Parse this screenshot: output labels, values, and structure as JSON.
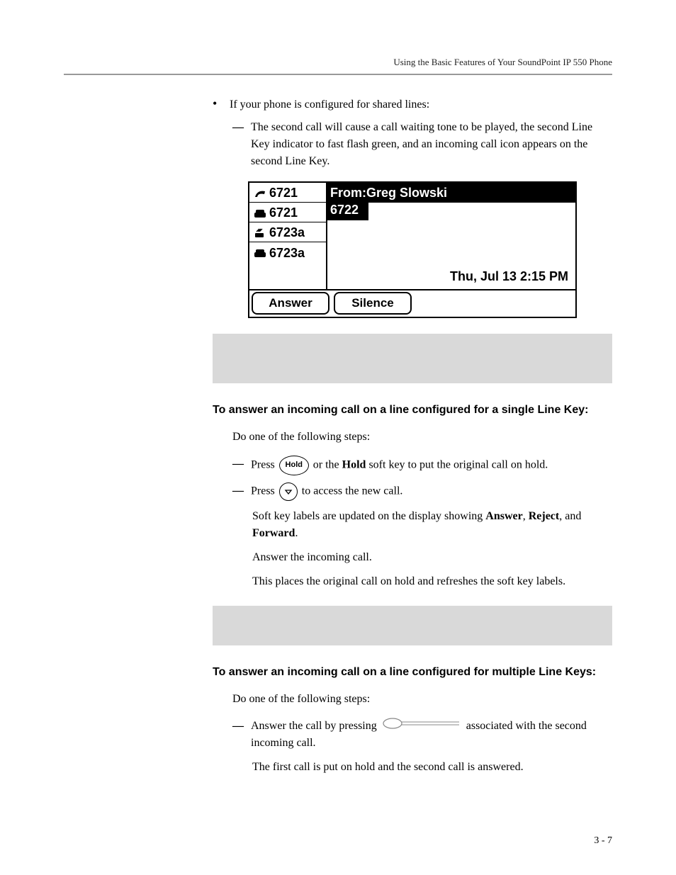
{
  "header": {
    "running": "Using the Basic Features of Your SoundPoint IP 550 Phone"
  },
  "bullet1": {
    "text": "If your phone is configured for shared lines:",
    "sub": "The second call will cause a call waiting tone to be played, the second Line Key indicator to fast flash green, and an incoming call icon appears on the second Line Key."
  },
  "phone": {
    "lines": {
      "l1": "6721",
      "l2": "6721",
      "l3": "6723a",
      "l4": "6723a"
    },
    "from": "From:Greg Slowski",
    "number": "6722",
    "datetime": "Thu, Jul 13  2:15 PM",
    "softkeys": {
      "k1": "Answer",
      "k2": "Silence"
    }
  },
  "section1": {
    "heading": "To answer an incoming call on a line configured for a single Line Key:",
    "intro": "Do one of the following steps:",
    "step1_a": "Press ",
    "step1_key": "Hold",
    "step1_b": " or the ",
    "step1_bold": "Hold",
    "step1_c": " soft key to put the original call on hold.",
    "step2_a": "Press  ",
    "step2_b": " to access the new call.",
    "para1_a": "Soft key labels are updated on the display showing ",
    "para1_b1": "Answer",
    "para1_c1": ", ",
    "para1_b2": "Reject",
    "para1_c2": ", and ",
    "para1_b3": "Forward",
    "para1_c3": ".",
    "para2": "Answer the incoming call.",
    "para3": "This places the original call on hold and refreshes the soft key labels."
  },
  "section2": {
    "heading": "To answer an incoming call on a line configured for multiple Line Keys:",
    "intro": "Do one of the following steps:",
    "step1_a": "Answer the call by pressing ",
    "step1_b": " associated with the second incoming call.",
    "para1": "The first call is put on hold and the second call is answered."
  },
  "pagenum": "3 - 7"
}
